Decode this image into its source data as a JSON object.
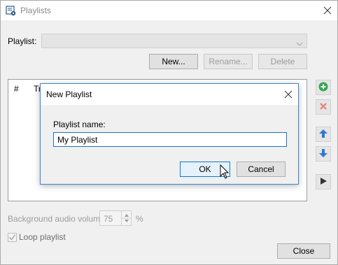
{
  "window": {
    "title": "Playlists",
    "icons": {
      "app": "playlist-gear-icon",
      "close": "close-icon"
    }
  },
  "playlist": {
    "label": "Playlist:",
    "selected": ""
  },
  "buttons": {
    "new": "New...",
    "rename": "Rename...",
    "delete": "Delete"
  },
  "list": {
    "columns": [
      "#",
      "Tr"
    ]
  },
  "side_buttons": [
    {
      "name": "add-icon",
      "color": "#2fa84f"
    },
    {
      "name": "remove-icon",
      "color": "#e04a3a"
    },
    {
      "name": "move-up-icon",
      "color": "#2f7bd1"
    },
    {
      "name": "move-down-icon",
      "color": "#2f7bd1"
    },
    {
      "name": "play-icon",
      "color": "#333333"
    }
  ],
  "volume": {
    "label": "Background audio volume:",
    "value": "75",
    "unit": "%"
  },
  "loop": {
    "label": "Loop playlist",
    "checked": true
  },
  "close_button": "Close",
  "dialog": {
    "title": "New Playlist",
    "name_label": "Playlist name:",
    "name_value": "My Playlist",
    "ok": "OK",
    "cancel": "Cancel"
  }
}
